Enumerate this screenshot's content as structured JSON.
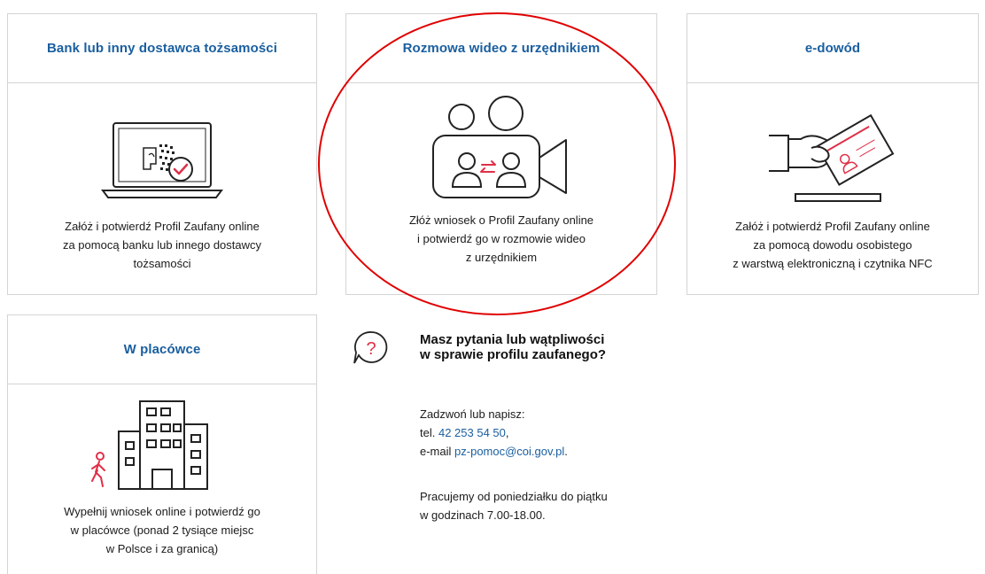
{
  "cards": {
    "bank": {
      "title": "Bank lub inny dostawca tożsamości",
      "desc": [
        "Załóż i potwierdź Profil Zaufany online",
        "za pomocą banku lub innego dostawcy",
        "tożsamości"
      ]
    },
    "video": {
      "title": "Rozmowa wideo z urzędnikiem",
      "desc": [
        "Złóż wniosek o Profil Zaufany online",
        "i potwierdź go w rozmowie wideo",
        "z urzędnikiem"
      ]
    },
    "edowod": {
      "title": "e-dowód",
      "desc": [
        "Załóż i potwierdź Profil Zaufany online",
        "za pomocą dowodu osobistego",
        "z warstwą elektroniczną i czytnika NFC"
      ]
    },
    "placowka": {
      "title": "W placówce",
      "desc": [
        "Wypełnij wniosek online i potwierdź go",
        "w placówce (ponad 2 tysiące miejsc",
        "w Polsce i za granicą)"
      ]
    }
  },
  "help": {
    "title_lines": [
      "Masz pytania lub wątpliwości",
      "w sprawie profilu zaufanego?"
    ],
    "contact_intro": "Zadzwoń lub napisz:",
    "tel_prefix": "tel.",
    "tel": "42 253 54 50",
    "tel_suffix": ",",
    "email_prefix": "e-mail",
    "email": "pz-pomoc@coi.gov.pl",
    "email_suffix": ".",
    "hours": [
      "Pracujemy od poniedziałku do piątku",
      "w godzinach 7.00-18.00."
    ]
  },
  "icons": {
    "bank": "laptop-verification-icon",
    "video": "video-call-icon",
    "edowod": "id-card-hand-icon",
    "placowka": "office-building-icon",
    "help": "question-bubble-icon"
  },
  "colors": {
    "accent": "#1a5fa0",
    "highlight": "#e03048",
    "annotation": "#e00000"
  }
}
